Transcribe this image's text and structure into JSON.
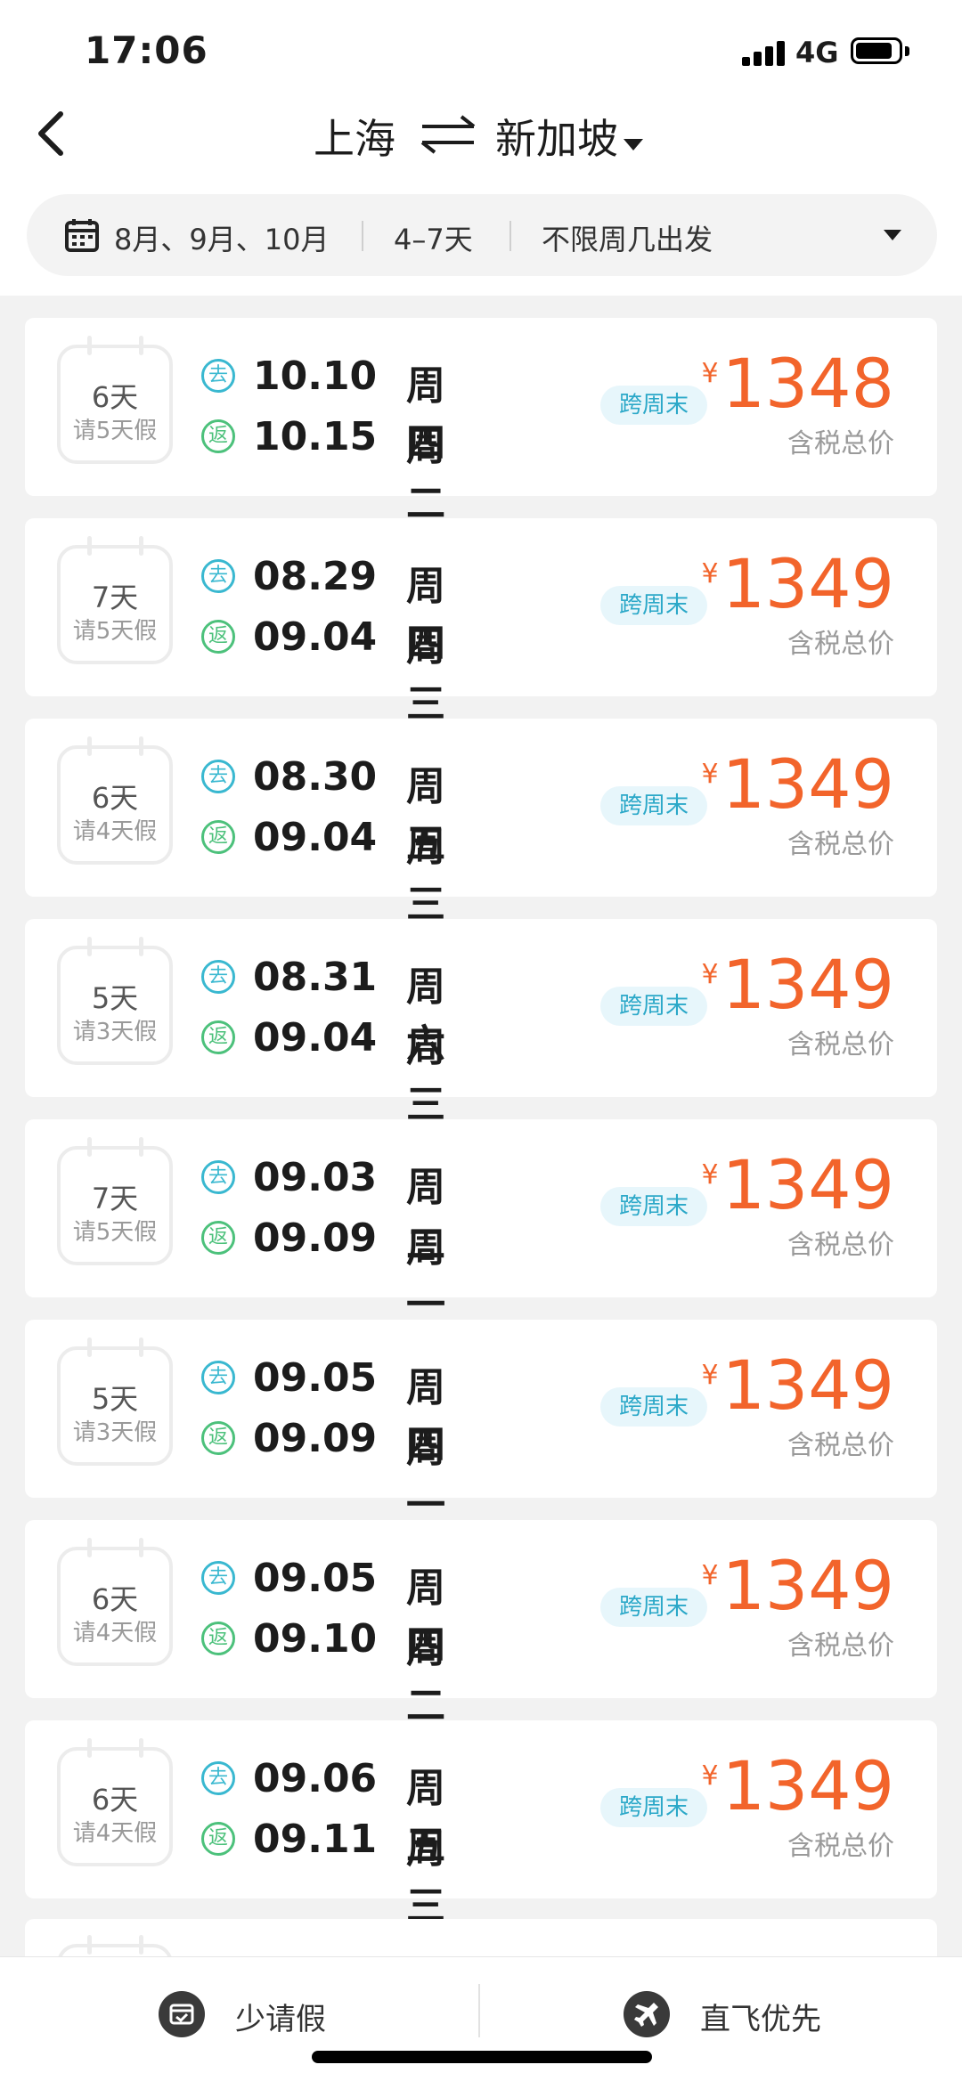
{
  "status": {
    "time": "17:06",
    "network": "4G"
  },
  "header": {
    "from": "上海",
    "to": "新加坡",
    "filters": {
      "months": "8月、9月、10月",
      "days": "4–7天",
      "weekday": "不限周几出发"
    }
  },
  "labels": {
    "out": "去",
    "ret": "返",
    "currency": "¥",
    "price_note": "含税总价"
  },
  "colors": {
    "price": "#f2642b",
    "out_badge": "#39b8d0",
    "ret_badge": "#4cc17b",
    "tag_bg": "#e7f6fb"
  },
  "results": [
    {
      "days": "6天",
      "leave": "请5天假",
      "out_date": "10.10",
      "out_wd": "周四",
      "ret_date": "10.15",
      "ret_wd": "周二",
      "tag": "跨周末",
      "price": "1348"
    },
    {
      "days": "7天",
      "leave": "请5天假",
      "out_date": "08.29",
      "out_wd": "周四",
      "ret_date": "09.04",
      "ret_wd": "周三",
      "tag": "跨周末",
      "price": "1349"
    },
    {
      "days": "6天",
      "leave": "请4天假",
      "out_date": "08.30",
      "out_wd": "周五",
      "ret_date": "09.04",
      "ret_wd": "周三",
      "tag": "跨周末",
      "price": "1349"
    },
    {
      "days": "5天",
      "leave": "请3天假",
      "out_date": "08.31",
      "out_wd": "周六",
      "ret_date": "09.04",
      "ret_wd": "周三",
      "tag": "跨周末",
      "price": "1349"
    },
    {
      "days": "7天",
      "leave": "请5天假",
      "out_date": "09.03",
      "out_wd": "周二",
      "ret_date": "09.09",
      "ret_wd": "周一",
      "tag": "跨周末",
      "price": "1349"
    },
    {
      "days": "5天",
      "leave": "请3天假",
      "out_date": "09.05",
      "out_wd": "周四",
      "ret_date": "09.09",
      "ret_wd": "周一",
      "tag": "跨周末",
      "price": "1349"
    },
    {
      "days": "6天",
      "leave": "请4天假",
      "out_date": "09.05",
      "out_wd": "周四",
      "ret_date": "09.10",
      "ret_wd": "周二",
      "tag": "跨周末",
      "price": "1349"
    },
    {
      "days": "6天",
      "leave": "请4天假",
      "out_date": "09.06",
      "out_wd": "周五",
      "ret_date": "09.11",
      "ret_wd": "周三",
      "tag": "跨周末",
      "price": "1349"
    }
  ],
  "tabs": {
    "left": "少请假",
    "right": "直飞优先"
  }
}
